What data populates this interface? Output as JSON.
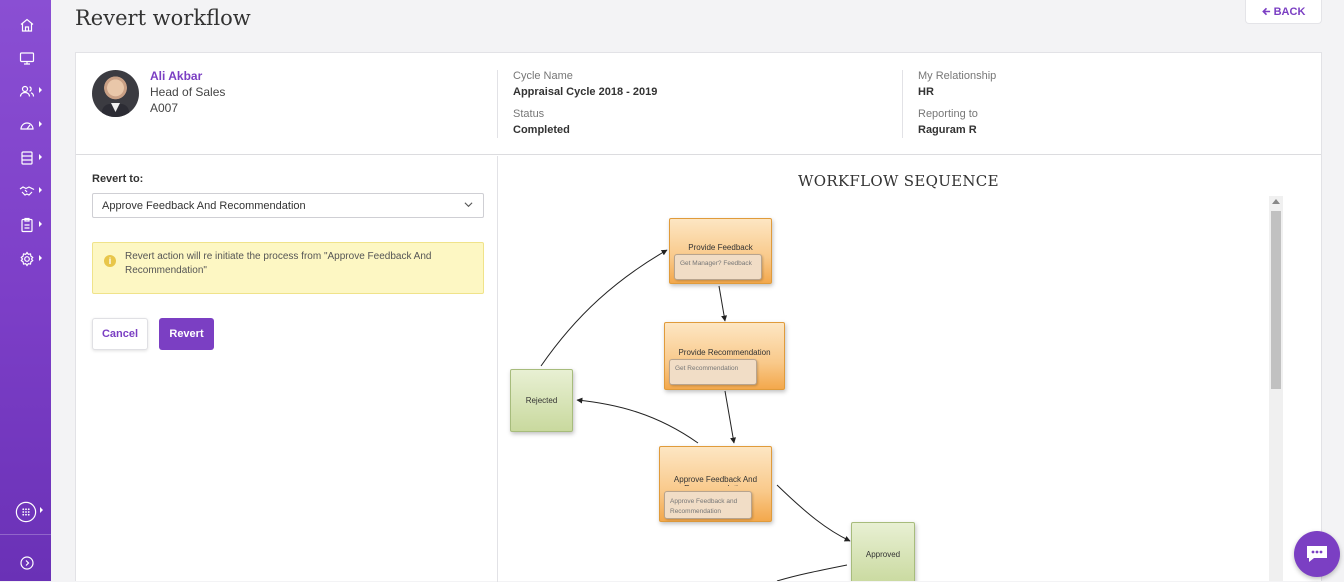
{
  "page": {
    "title": "Revert workflow",
    "back_label": "BACK"
  },
  "sidebar": {
    "items": [
      {
        "icon": "home-icon"
      },
      {
        "icon": "monitor-icon"
      },
      {
        "icon": "users-icon"
      },
      {
        "icon": "dashboard-icon"
      },
      {
        "icon": "document-stack-icon"
      },
      {
        "icon": "handshake-icon"
      },
      {
        "icon": "clipboard-icon"
      },
      {
        "icon": "settings-icon"
      }
    ],
    "apps_icon": "apps-grid-icon",
    "expand_icon": "expand-chevron-icon"
  },
  "employee": {
    "name": "Ali Akbar",
    "role": "Head of Sales",
    "id": "A007"
  },
  "cycle": {
    "name_label": "Cycle Name",
    "name_value": "Appraisal Cycle 2018 - 2019",
    "status_label": "Status",
    "status_value": "Completed"
  },
  "relationship": {
    "label": "My Relationship",
    "value": "HR",
    "reporting_label": "Reporting to",
    "reporting_value": "Raguram R"
  },
  "form": {
    "revert_to_label": "Revert to:",
    "revert_to_value": "Approve Feedback And Recommendation",
    "alert_text": "Revert action will re initiate the process from \"Approve Feedback And Recommendation\"",
    "cancel_label": "Cancel",
    "revert_label": "Revert"
  },
  "workflow": {
    "title": "WORKFLOW SEQUENCE",
    "nodes": {
      "provide_feedback": {
        "title": "Provide Feedback",
        "sub": "Get Manager? Feedback"
      },
      "provide_recommendation": {
        "title": "Provide Recommendation",
        "sub": "Get Recommendation"
      },
      "approve_feedback": {
        "title": "Approve Feedback And Recommendation",
        "sub": "Approve Feedback and Recommendation"
      },
      "rejected": {
        "title": "Rejected"
      },
      "approved": {
        "title": "Approved"
      }
    }
  },
  "colors": {
    "accent": "#7b3fc3",
    "alert_bg": "#fdf7c3",
    "task_node": "#f9c98a",
    "terminal_node": "#c9d99e"
  }
}
